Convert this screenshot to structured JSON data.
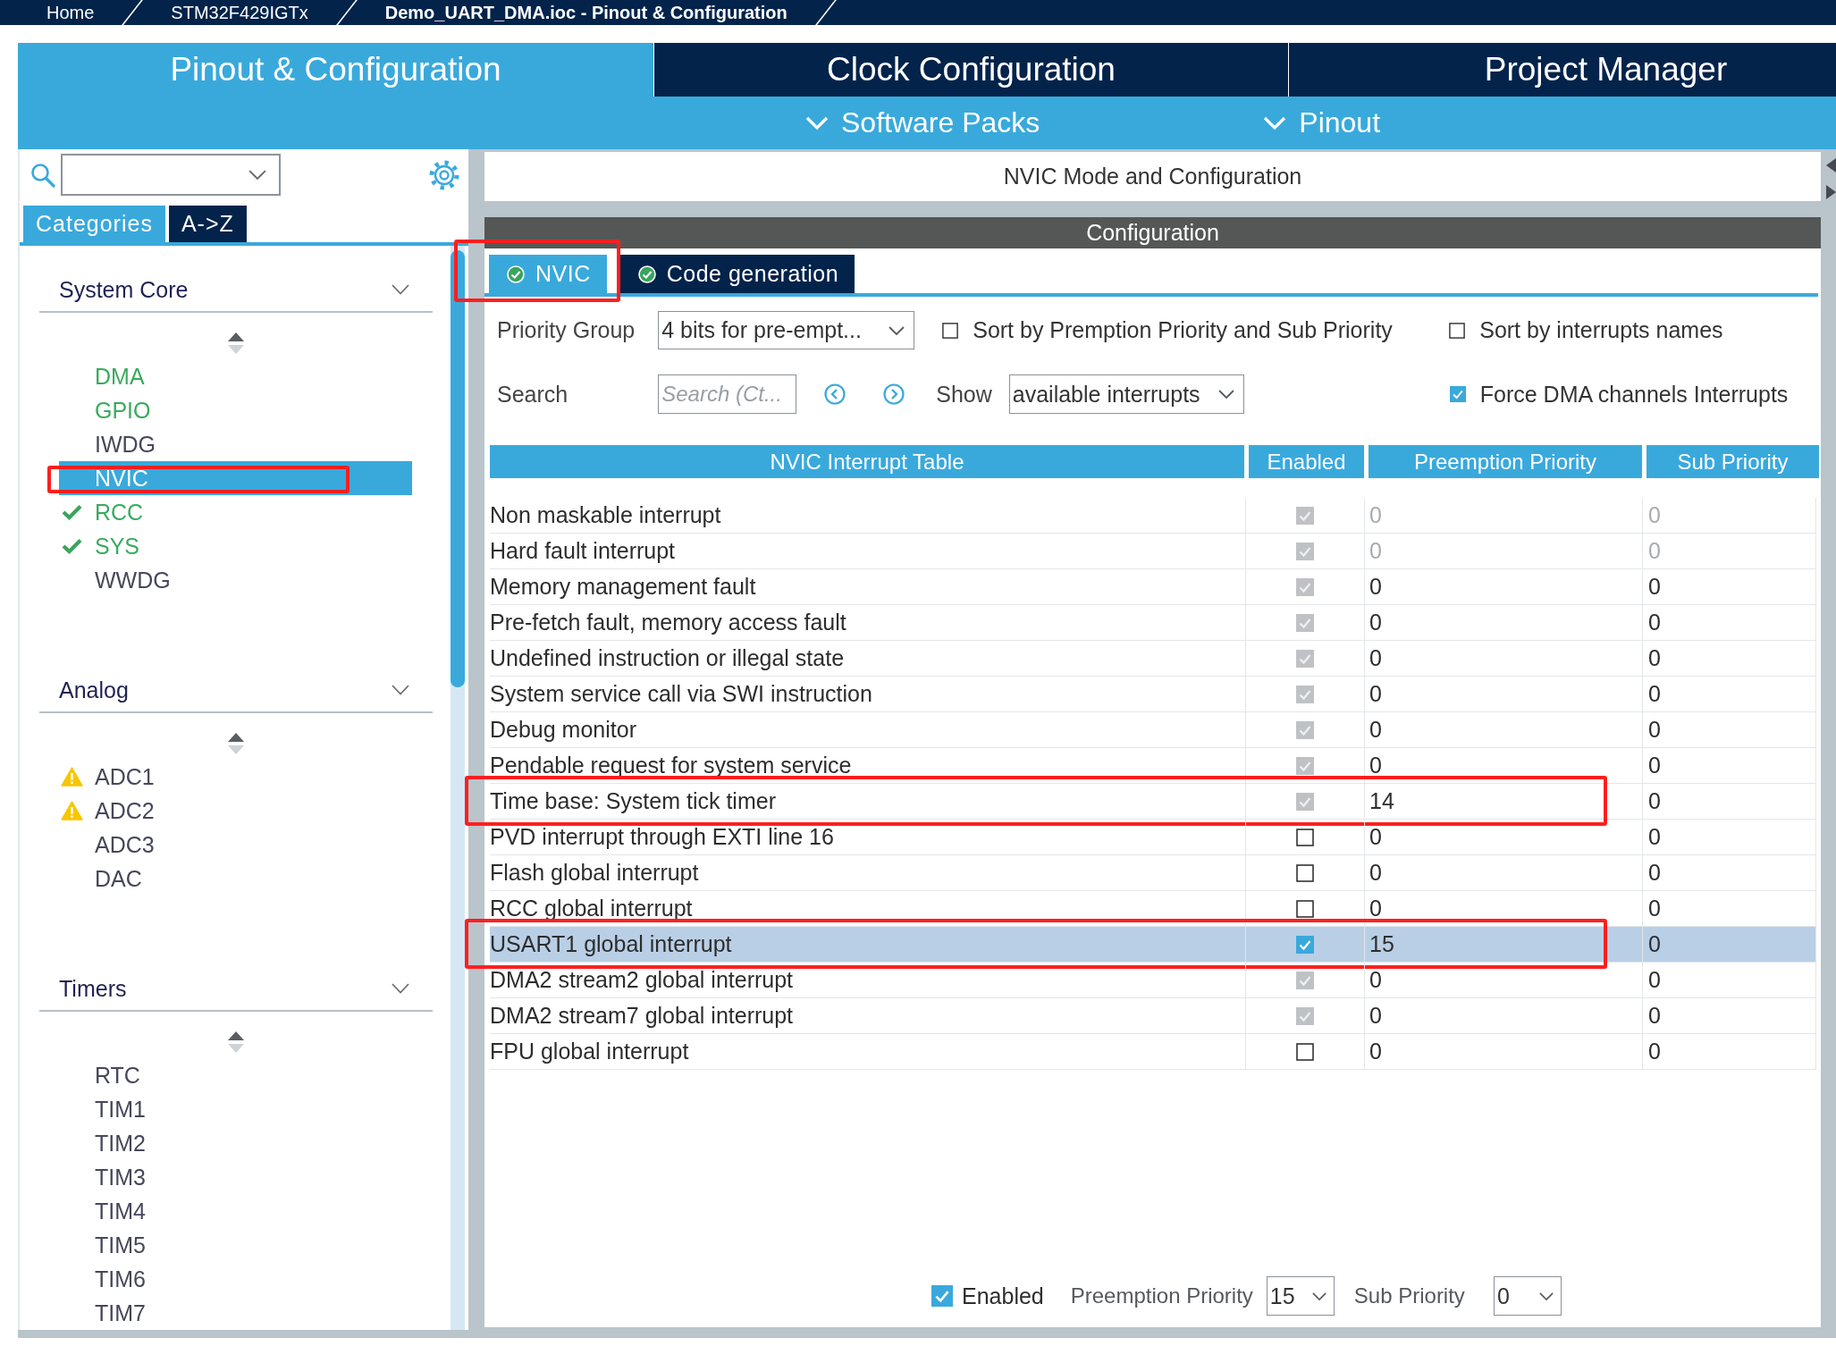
{
  "breadcrumb": [
    {
      "label": "Home",
      "current": false
    },
    {
      "label": "STM32F429IGTx",
      "current": false
    },
    {
      "label": "Demo_UART_DMA.ioc - Pinout & Configuration",
      "current": true
    }
  ],
  "main_tabs": [
    {
      "label": "Pinout & Configuration",
      "selected": true
    },
    {
      "label": "Clock Configuration",
      "selected": false
    },
    {
      "label": "Project Manager",
      "selected": false
    }
  ],
  "sub_menu": [
    {
      "label": "Software Packs"
    },
    {
      "label": "Pinout"
    }
  ],
  "sidebar": {
    "view_tabs": [
      {
        "label": "Categories",
        "selected": true
      },
      {
        "label": "A->Z",
        "selected": false
      }
    ],
    "groups": [
      {
        "title": "System Core",
        "expanded": true,
        "items": [
          {
            "label": "DMA",
            "configured": true,
            "verified": false,
            "warning": false,
            "selected": false,
            "highlighted": false
          },
          {
            "label": "GPIO",
            "configured": true,
            "verified": false,
            "warning": false,
            "selected": false,
            "highlighted": false
          },
          {
            "label": "IWDG",
            "configured": false,
            "verified": false,
            "warning": false,
            "selected": false,
            "highlighted": false
          },
          {
            "label": "NVIC",
            "configured": false,
            "verified": false,
            "warning": false,
            "selected": true,
            "highlighted": true
          },
          {
            "label": "RCC",
            "configured": true,
            "verified": true,
            "warning": false,
            "selected": false,
            "highlighted": false
          },
          {
            "label": "SYS",
            "configured": true,
            "verified": true,
            "warning": false,
            "selected": false,
            "highlighted": false
          },
          {
            "label": "WWDG",
            "configured": false,
            "verified": false,
            "warning": false,
            "selected": false,
            "highlighted": false
          }
        ]
      },
      {
        "title": "Analog",
        "expanded": true,
        "items": [
          {
            "label": "ADC1",
            "configured": false,
            "verified": false,
            "warning": true,
            "selected": false,
            "highlighted": false
          },
          {
            "label": "ADC2",
            "configured": false,
            "verified": false,
            "warning": true,
            "selected": false,
            "highlighted": false
          },
          {
            "label": "ADC3",
            "configured": false,
            "verified": false,
            "warning": false,
            "selected": false,
            "highlighted": false
          },
          {
            "label": "DAC",
            "configured": false,
            "verified": false,
            "warning": false,
            "selected": false,
            "highlighted": false
          }
        ]
      },
      {
        "title": "Timers",
        "expanded": true,
        "items": [
          {
            "label": "RTC",
            "configured": false,
            "verified": false,
            "warning": false,
            "selected": false,
            "highlighted": false
          },
          {
            "label": "TIM1",
            "configured": false,
            "verified": false,
            "warning": false,
            "selected": false,
            "highlighted": false
          },
          {
            "label": "TIM2",
            "configured": false,
            "verified": false,
            "warning": false,
            "selected": false,
            "highlighted": false
          },
          {
            "label": "TIM3",
            "configured": false,
            "verified": false,
            "warning": false,
            "selected": false,
            "highlighted": false
          },
          {
            "label": "TIM4",
            "configured": false,
            "verified": false,
            "warning": false,
            "selected": false,
            "highlighted": false
          },
          {
            "label": "TIM5",
            "configured": false,
            "verified": false,
            "warning": false,
            "selected": false,
            "highlighted": false
          },
          {
            "label": "TIM6",
            "configured": false,
            "verified": false,
            "warning": false,
            "selected": false,
            "highlighted": false
          },
          {
            "label": "TIM7",
            "configured": false,
            "verified": false,
            "warning": false,
            "selected": false,
            "highlighted": false
          }
        ]
      }
    ]
  },
  "panel": {
    "title": "NVIC Mode and Configuration",
    "section_title": "Configuration",
    "tabs": [
      {
        "label": "NVIC",
        "selected": true,
        "verified": true,
        "highlighted": true
      },
      {
        "label": "Code generation",
        "selected": false,
        "verified": true,
        "highlighted": false
      }
    ],
    "priority_group": {
      "label": "Priority Group",
      "value": "4 bits for pre-empt..."
    },
    "sort_options": [
      {
        "label": "Sort by Premption Priority and Sub Priority",
        "checked": false
      },
      {
        "label": "Sort by interrupts names",
        "checked": false
      }
    ],
    "search": {
      "label": "Search",
      "placeholder": "Search (Ct..."
    },
    "show": {
      "label": "Show",
      "value": "available interrupts"
    },
    "force_dma": {
      "label": "Force DMA channels Interrupts",
      "checked": true
    },
    "table": {
      "columns": [
        "NVIC Interrupt Table",
        "Enabled",
        "Preemption Priority",
        "Sub Priority"
      ],
      "rows": [
        {
          "name": "Non maskable interrupt",
          "enabled": true,
          "locked": true,
          "fixed": true,
          "preemption": "0",
          "sub_priority": "0",
          "selected": false,
          "highlighted": false
        },
        {
          "name": "Hard fault interrupt",
          "enabled": true,
          "locked": true,
          "fixed": true,
          "preemption": "0",
          "sub_priority": "0",
          "selected": false,
          "highlighted": false
        },
        {
          "name": "Memory management fault",
          "enabled": true,
          "locked": true,
          "fixed": false,
          "preemption": "0",
          "sub_priority": "0",
          "selected": false,
          "highlighted": false
        },
        {
          "name": "Pre-fetch fault, memory access fault",
          "enabled": true,
          "locked": true,
          "fixed": false,
          "preemption": "0",
          "sub_priority": "0",
          "selected": false,
          "highlighted": false
        },
        {
          "name": "Undefined instruction or illegal state",
          "enabled": true,
          "locked": true,
          "fixed": false,
          "preemption": "0",
          "sub_priority": "0",
          "selected": false,
          "highlighted": false
        },
        {
          "name": "System service call via SWI instruction",
          "enabled": true,
          "locked": true,
          "fixed": false,
          "preemption": "0",
          "sub_priority": "0",
          "selected": false,
          "highlighted": false
        },
        {
          "name": "Debug monitor",
          "enabled": true,
          "locked": true,
          "fixed": false,
          "preemption": "0",
          "sub_priority": "0",
          "selected": false,
          "highlighted": false
        },
        {
          "name": "Pendable request for system service",
          "enabled": true,
          "locked": true,
          "fixed": false,
          "preemption": "0",
          "sub_priority": "0",
          "selected": false,
          "highlighted": false
        },
        {
          "name": "Time base: System tick timer",
          "enabled": true,
          "locked": true,
          "fixed": false,
          "preemption": "14",
          "sub_priority": "0",
          "selected": false,
          "highlighted": true
        },
        {
          "name": "PVD interrupt through EXTI line 16",
          "enabled": false,
          "locked": false,
          "fixed": false,
          "preemption": "0",
          "sub_priority": "0",
          "selected": false,
          "highlighted": false
        },
        {
          "name": "Flash global interrupt",
          "enabled": false,
          "locked": false,
          "fixed": false,
          "preemption": "0",
          "sub_priority": "0",
          "selected": false,
          "highlighted": false
        },
        {
          "name": "RCC global interrupt",
          "enabled": false,
          "locked": false,
          "fixed": false,
          "preemption": "0",
          "sub_priority": "0",
          "selected": false,
          "highlighted": false
        },
        {
          "name": "USART1 global interrupt",
          "enabled": true,
          "locked": false,
          "fixed": false,
          "preemption": "15",
          "sub_priority": "0",
          "selected": true,
          "highlighted": true
        },
        {
          "name": "DMA2 stream2 global interrupt",
          "enabled": true,
          "locked": true,
          "fixed": false,
          "preemption": "0",
          "sub_priority": "0",
          "selected": false,
          "highlighted": false
        },
        {
          "name": "DMA2 stream7 global interrupt",
          "enabled": true,
          "locked": true,
          "fixed": false,
          "preemption": "0",
          "sub_priority": "0",
          "selected": false,
          "highlighted": false
        },
        {
          "name": "FPU global interrupt",
          "enabled": false,
          "locked": false,
          "fixed": false,
          "preemption": "0",
          "sub_priority": "0",
          "selected": false,
          "highlighted": false
        }
      ]
    },
    "footer": {
      "enabled": {
        "label": "Enabled",
        "checked": true
      },
      "preemption": {
        "label": "Preemption Priority",
        "value": "15"
      },
      "sub_priority": {
        "label": "Sub Priority",
        "value": "0"
      }
    }
  }
}
